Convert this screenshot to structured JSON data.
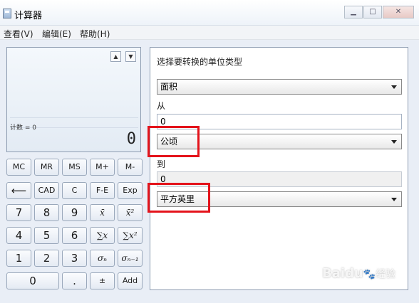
{
  "window": {
    "title": "计算器"
  },
  "menu": [
    {
      "label": "查看(V)"
    },
    {
      "label": "编辑(E)"
    },
    {
      "label": "帮助(H)"
    }
  ],
  "display": {
    "count_label": "计数 = 0",
    "value": "0",
    "scroll_up": "▲",
    "scroll_down": "▼"
  },
  "keypad": {
    "row1": [
      "MC",
      "MR",
      "MS",
      "M+",
      "M-"
    ],
    "row2": [
      "⟵",
      "CAD",
      "C",
      "F-E",
      "Exp"
    ],
    "row3": [
      "7",
      "8",
      "9",
      "x̄",
      "x̄²"
    ],
    "row4": [
      "4",
      "5",
      "6",
      "∑x",
      "∑x²"
    ],
    "row5": [
      "1",
      "2",
      "3",
      "σₙ",
      "σₙ₋₁"
    ],
    "row6": [
      "0",
      ".",
      "±",
      "Add"
    ]
  },
  "converter": {
    "prompt": "选择要转换的单位类型",
    "unit_type": "面积",
    "from_label": "从",
    "from_value": "0",
    "from_unit": "公顷",
    "to_label": "到",
    "to_value": "0",
    "to_unit": "平方英里"
  },
  "watermark": {
    "text": "Baidu",
    "sub": "经验"
  },
  "colors": {
    "highlight": "#e4131b"
  }
}
